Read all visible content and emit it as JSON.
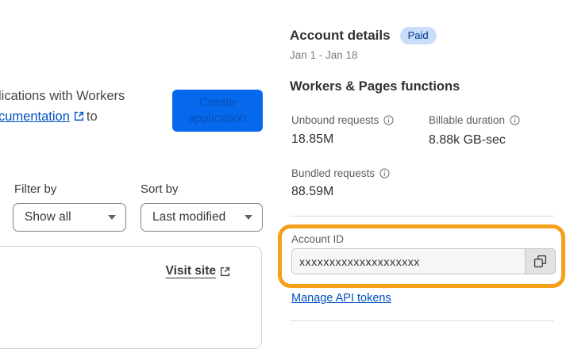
{
  "left_panel": {
    "intro_line1": "lications with Workers",
    "intro_link_text": "cumentation",
    "intro_after_link": "to",
    "create_button_label": "Create application",
    "filter": {
      "label": "Filter by",
      "selected": "Show all"
    },
    "sort": {
      "label": "Sort by",
      "selected": "Last modified"
    },
    "visit_site_label": "Visit site"
  },
  "account_panel": {
    "title": "Account details",
    "plan_badge": "Paid",
    "date_range": "Jan 1 - Jan 18",
    "section_title": "Workers & Pages functions",
    "stats": [
      {
        "label": "Unbound requests",
        "value": "18.85M"
      },
      {
        "label": "Billable duration",
        "value": "8.88k GB-sec"
      },
      {
        "label": "Bundled requests",
        "value": "88.59M"
      }
    ],
    "account_id": {
      "label": "Account ID",
      "value": "xxxxxxxxxxxxxxxxxxxx"
    },
    "manage_tokens_label": "Manage API tokens"
  },
  "colors": {
    "accent_blue": "#0669ed",
    "link_blue": "#0051c3",
    "badge_bg": "#c8ddfa",
    "badge_text": "#003681",
    "highlight_orange": "#f5a01b"
  }
}
